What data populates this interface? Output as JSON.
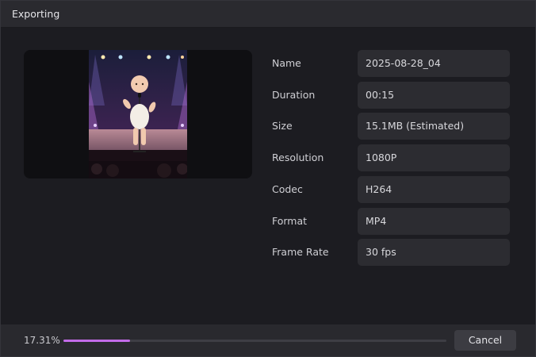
{
  "dialog": {
    "title": "Exporting"
  },
  "preview": {
    "alt": "baby on stage with microphone"
  },
  "properties": [
    {
      "label": "Name",
      "value": "2025-08-28_04"
    },
    {
      "label": "Duration",
      "value": "00:15"
    },
    {
      "label": "Size",
      "value": "15.1MB (Estimated)"
    },
    {
      "label": "Resolution",
      "value": "1080P"
    },
    {
      "label": "Codec",
      "value": "H264"
    },
    {
      "label": "Format",
      "value": "MP4"
    },
    {
      "label": "Frame Rate",
      "value": "30 fps"
    }
  ],
  "progress": {
    "percent_label": "17.31%",
    "fraction": 0.1731,
    "color": "#c26be8"
  },
  "footer": {
    "cancel_label": "Cancel"
  }
}
